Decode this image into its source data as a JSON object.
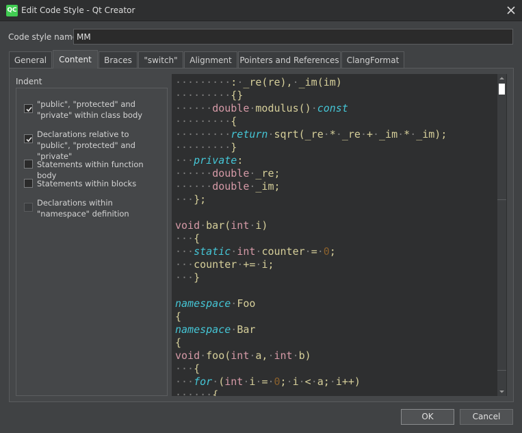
{
  "window": {
    "title": "Edit Code Style - Qt Creator",
    "app_icon_text": "QC",
    "close_icon": "close-icon"
  },
  "code_style_name": {
    "label": "Code style name:",
    "value": "MM"
  },
  "tabs": [
    {
      "label": "General"
    },
    {
      "label": "Content",
      "active": true
    },
    {
      "label": "Braces"
    },
    {
      "label": "\"switch\""
    },
    {
      "label": "Alignment"
    },
    {
      "label": "Pointers and References"
    },
    {
      "label": "ClangFormat"
    }
  ],
  "indent_group": {
    "title": "Indent",
    "options": [
      {
        "label": "\"public\", \"protected\" and \"private\" within class body",
        "checked": true,
        "enabled": true
      },
      {
        "label": "Declarations relative to \"public\", \"protected\" and \"private\"",
        "checked": true,
        "enabled": true
      },
      {
        "label": "Statements within function body",
        "checked": false,
        "enabled": true
      },
      {
        "label": "Statements within blocks",
        "checked": false,
        "enabled": true
      },
      {
        "label": "Declarations within \"namespace\" definition",
        "checked": false,
        "enabled": false
      }
    ]
  },
  "code_preview": {
    "lines": [
      [
        [
          "ws",
          "·········"
        ],
        [
          "p",
          ":"
        ],
        [
          "ws",
          "·"
        ],
        [
          "p",
          "_re(re),"
        ],
        [
          "ws",
          "·"
        ],
        [
          "p",
          "_im(im)"
        ]
      ],
      [
        [
          "ws",
          "·········"
        ],
        [
          "p",
          "{}"
        ]
      ],
      [
        [
          "ws",
          "······"
        ],
        [
          "t",
          "double"
        ],
        [
          "ws",
          "·"
        ],
        [
          "p",
          "modulus()"
        ],
        [
          "ws",
          "·"
        ],
        [
          "k",
          "const"
        ]
      ],
      [
        [
          "ws",
          "·········"
        ],
        [
          "p",
          "{"
        ]
      ],
      [
        [
          "ws",
          "·········"
        ],
        [
          "k",
          "return"
        ],
        [
          "ws",
          "·"
        ],
        [
          "p",
          "sqrt(_re"
        ],
        [
          "ws",
          "·"
        ],
        [
          "p",
          "*"
        ],
        [
          "ws",
          "·"
        ],
        [
          "p",
          "_re"
        ],
        [
          "ws",
          "·"
        ],
        [
          "p",
          "+"
        ],
        [
          "ws",
          "·"
        ],
        [
          "p",
          "_im"
        ],
        [
          "ws",
          "·"
        ],
        [
          "p",
          "*"
        ],
        [
          "ws",
          "·"
        ],
        [
          "p",
          "_im);"
        ]
      ],
      [
        [
          "ws",
          "·········"
        ],
        [
          "p",
          "}"
        ]
      ],
      [
        [
          "ws",
          "···"
        ],
        [
          "k",
          "private"
        ],
        [
          "p",
          ":"
        ]
      ],
      [
        [
          "ws",
          "······"
        ],
        [
          "t",
          "double"
        ],
        [
          "ws",
          "·"
        ],
        [
          "p",
          "_re;"
        ]
      ],
      [
        [
          "ws",
          "······"
        ],
        [
          "t",
          "double"
        ],
        [
          "ws",
          "·"
        ],
        [
          "p",
          "_im;"
        ]
      ],
      [
        [
          "ws",
          "···"
        ],
        [
          "p",
          "};"
        ]
      ],
      [],
      [
        [
          "t",
          "void"
        ],
        [
          "ws",
          "·"
        ],
        [
          "p",
          "bar("
        ],
        [
          "t",
          "int"
        ],
        [
          "ws",
          "·"
        ],
        [
          "p",
          "i)"
        ]
      ],
      [
        [
          "ws",
          "···"
        ],
        [
          "p",
          "{"
        ]
      ],
      [
        [
          "ws",
          "···"
        ],
        [
          "k",
          "static"
        ],
        [
          "ws",
          "·"
        ],
        [
          "t",
          "int"
        ],
        [
          "ws",
          "·"
        ],
        [
          "p",
          "counter"
        ],
        [
          "ws",
          "·"
        ],
        [
          "p",
          "="
        ],
        [
          "ws",
          "·"
        ],
        [
          "n",
          "0"
        ],
        [
          "p",
          ";"
        ]
      ],
      [
        [
          "ws",
          "···"
        ],
        [
          "p",
          "counter"
        ],
        [
          "ws",
          "·"
        ],
        [
          "p",
          "+="
        ],
        [
          "ws",
          "·"
        ],
        [
          "p",
          "i;"
        ]
      ],
      [
        [
          "ws",
          "···"
        ],
        [
          "p",
          "}"
        ]
      ],
      [],
      [
        [
          "k",
          "namespace"
        ],
        [
          "ws",
          "·"
        ],
        [
          "p",
          "Foo"
        ]
      ],
      [
        [
          "p",
          "{"
        ]
      ],
      [
        [
          "k",
          "namespace"
        ],
        [
          "ws",
          "·"
        ],
        [
          "p",
          "Bar"
        ]
      ],
      [
        [
          "p",
          "{"
        ]
      ],
      [
        [
          "t",
          "void"
        ],
        [
          "ws",
          "·"
        ],
        [
          "p",
          "foo("
        ],
        [
          "t",
          "int"
        ],
        [
          "ws",
          "·"
        ],
        [
          "p",
          "a,"
        ],
        [
          "ws",
          "·"
        ],
        [
          "t",
          "int"
        ],
        [
          "ws",
          "·"
        ],
        [
          "p",
          "b)"
        ]
      ],
      [
        [
          "ws",
          "···"
        ],
        [
          "p",
          "{"
        ]
      ],
      [
        [
          "ws",
          "···"
        ],
        [
          "k",
          "for"
        ],
        [
          "ws",
          "·"
        ],
        [
          "p",
          "("
        ],
        [
          "t",
          "int"
        ],
        [
          "ws",
          "·"
        ],
        [
          "p",
          "i"
        ],
        [
          "ws",
          "·"
        ],
        [
          "p",
          "="
        ],
        [
          "ws",
          "·"
        ],
        [
          "n",
          "0"
        ],
        [
          "p",
          ";"
        ],
        [
          "ws",
          "·"
        ],
        [
          "p",
          "i"
        ],
        [
          "ws",
          "·"
        ],
        [
          "p",
          "<"
        ],
        [
          "ws",
          "·"
        ],
        [
          "p",
          "a;"
        ],
        [
          "ws",
          "·"
        ],
        [
          "p",
          "i++)"
        ]
      ],
      [
        [
          "ws",
          "······"
        ],
        [
          "p",
          "{"
        ]
      ]
    ]
  },
  "buttons": {
    "ok": "OK",
    "cancel": "Cancel"
  },
  "colors": {
    "keyword": "#45c6d6",
    "type": "#d69aa7",
    "number": "#8a602c",
    "whitespace": "#7d7d7d",
    "plain": "#d6cf9a",
    "background": "#404244",
    "editor_background": "#2e2f30"
  }
}
